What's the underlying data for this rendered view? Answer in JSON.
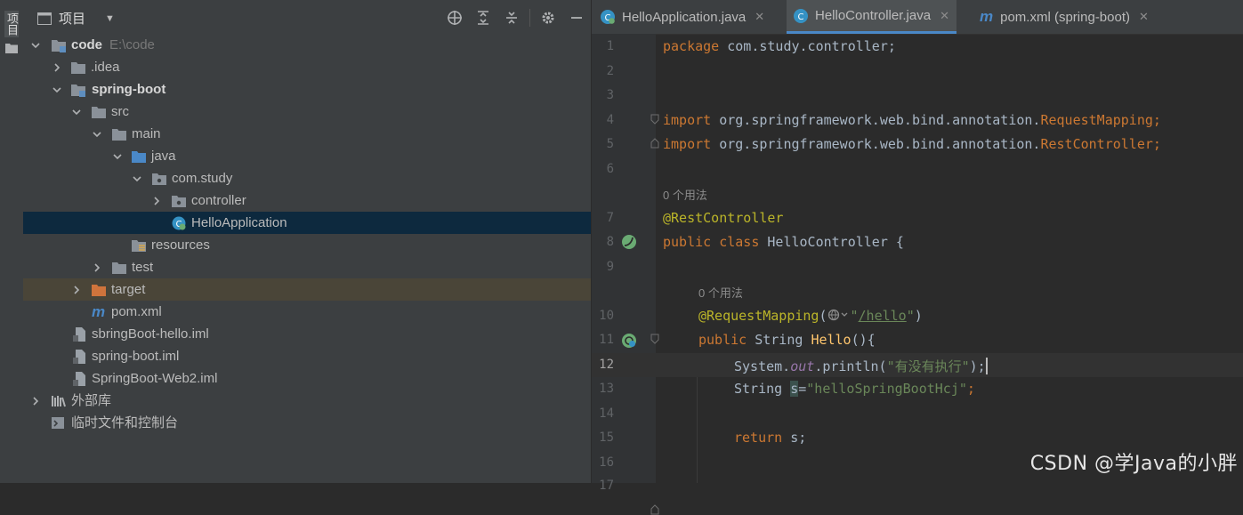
{
  "strip": {
    "label": "项目"
  },
  "project": {
    "title": "项目",
    "tree": [
      {
        "label": "code",
        "hint": "E:\\code",
        "bold": true
      },
      {
        "label": ".idea"
      },
      {
        "label": "spring-boot",
        "bold": true
      },
      {
        "label": "src"
      },
      {
        "label": "main"
      },
      {
        "label": "java"
      },
      {
        "label": "com.study"
      },
      {
        "label": "controller"
      },
      {
        "label": "HelloApplication"
      },
      {
        "label": "resources"
      },
      {
        "label": "test"
      },
      {
        "label": "target"
      },
      {
        "label": "pom.xml"
      },
      {
        "label": "sbringBoot-hello.iml"
      },
      {
        "label": "spring-boot.iml"
      },
      {
        "label": "SpringBoot-Web2.iml"
      },
      {
        "label": "外部库"
      },
      {
        "label": "临时文件和控制台"
      }
    ]
  },
  "tabs": [
    {
      "label": "HelloApplication.java"
    },
    {
      "label": "HelloController.java"
    },
    {
      "label": "pom.xml (spring-boot)"
    }
  ],
  "editor": {
    "line_numbers": [
      "1",
      "2",
      "3",
      "4",
      "5",
      "6",
      "7",
      "8",
      "9",
      "10",
      "11",
      "12",
      "13",
      "14",
      "15",
      "16",
      "17"
    ],
    "usage_hint": "0 个用法",
    "code": {
      "l1_kw": "package",
      "l1_rest": " com.study.controller;",
      "l4_kw": "import",
      "l4_pkg": " org.springframework.web.bind.annotation.",
      "l4_cls": "RequestMapping",
      "l5_kw": "import",
      "l5_pkg": " org.springframework.web.bind.annotation.",
      "l5_cls": "RestController",
      "semicolon": ";",
      "l7": "@RestController",
      "l8_kw": "public class",
      "l8_name": " HelloController {",
      "l10_ann": "@RequestMapping",
      "l10_open": "(",
      "l10_q1": "\"",
      "l10_path": "/hello",
      "l10_q2": "\"",
      "l10_close": ")",
      "l11_kw": "public",
      "l11_type": " String ",
      "l11_fn": "Hello",
      "l11_rest": "(){",
      "l12_a": "System.",
      "l12_out": "out",
      "l12_b": ".println(",
      "l12_str": "\"有没有执行\"",
      "l12_c": ");",
      "l13_a": "String ",
      "l13_var": "s",
      "l13_eq": "=",
      "l13_str": "\"helloSpringBootHcj\"",
      "l13_c": ";",
      "l15_kw": "return",
      "l15_rest": " s;"
    }
  },
  "watermark": "CSDN @学Java的小胖"
}
